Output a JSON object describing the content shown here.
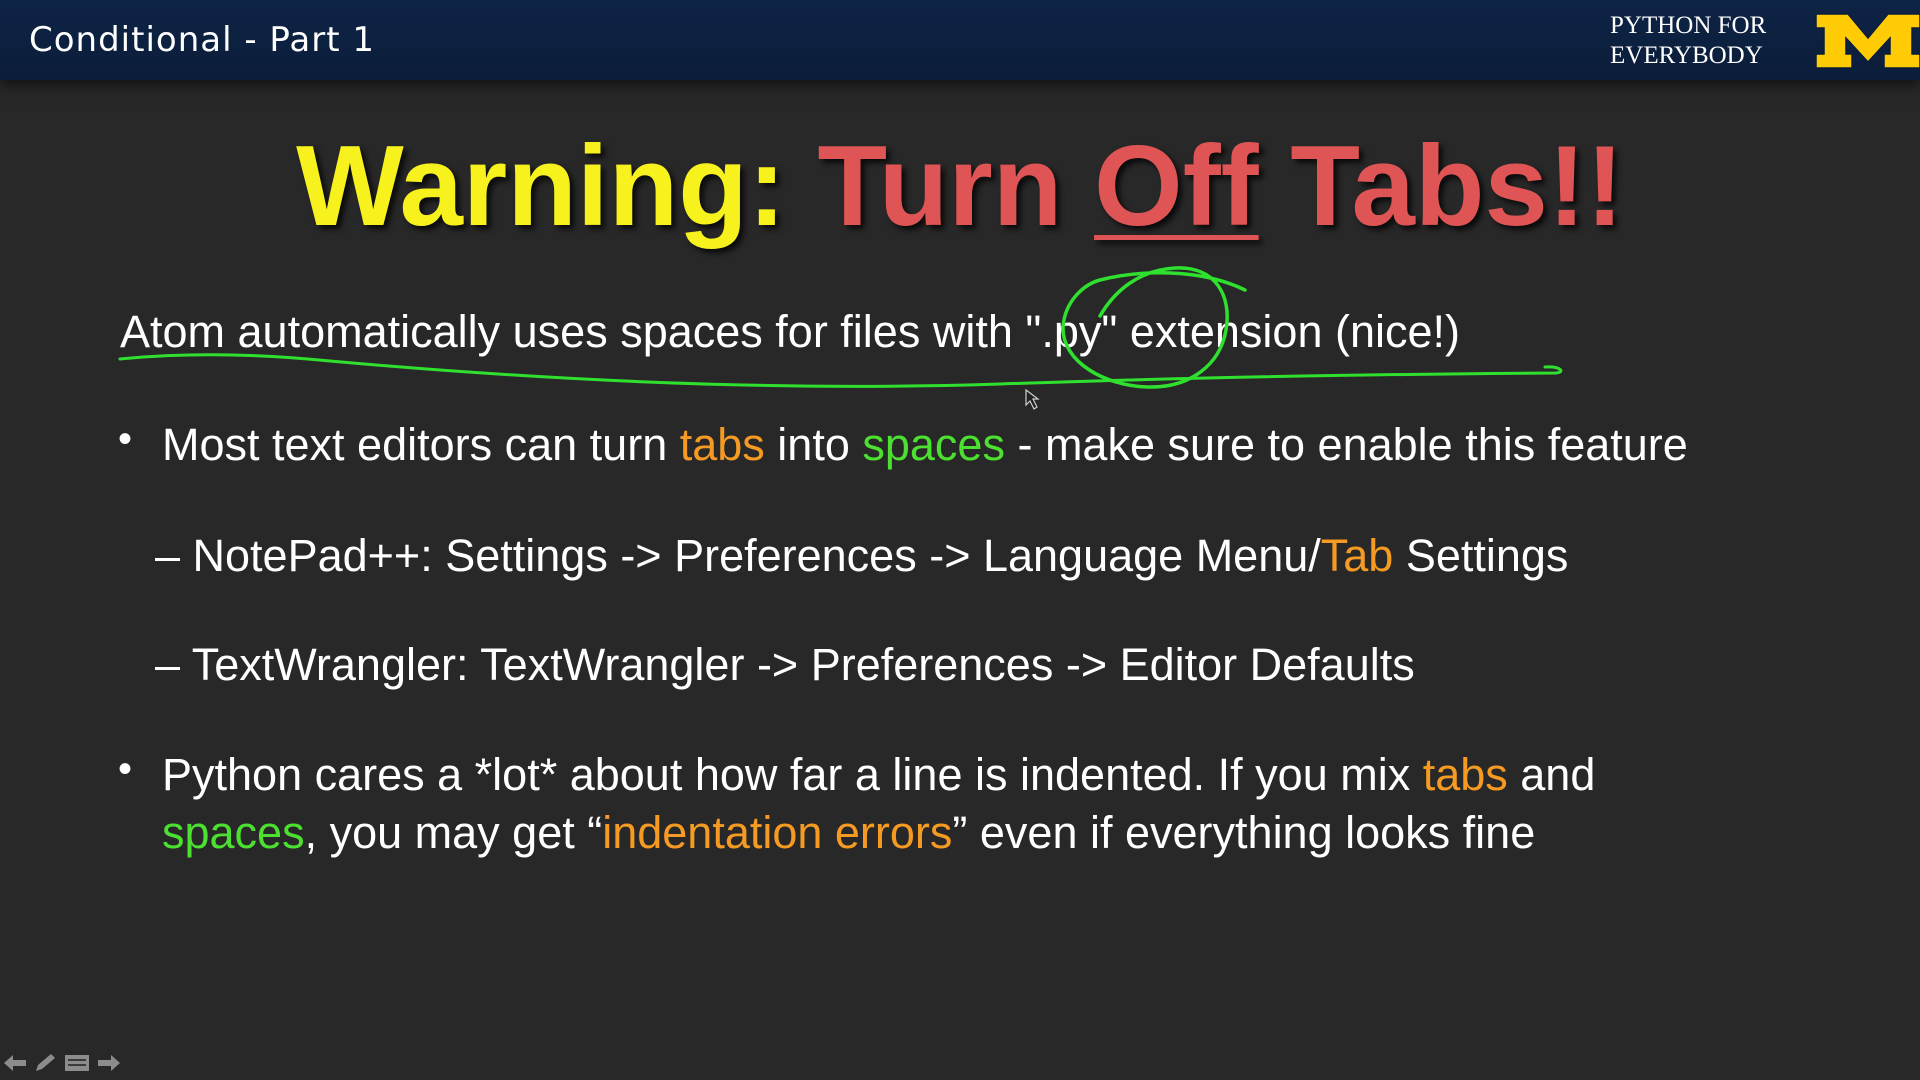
{
  "header": {
    "title": "Conditional - Part 1",
    "brand_line1": "PYTHON FOR",
    "brand_line2": "EVERYBODY",
    "logo_icon": "michigan-block-m-logo",
    "logo_color": "#ffcb05"
  },
  "slide": {
    "title": {
      "warning": "Warning:",
      "turn": "Turn",
      "off": "Off",
      "tabs": "Tabs!!"
    },
    "atom_line": "Atom automatically uses spaces for files with \".py\" extension (nice!)",
    "bullet1": {
      "p1": "Most text editors can turn ",
      "tabs": "tabs",
      "p2": " into ",
      "spaces": "spaces",
      "p3": " - make sure to enable this feature"
    },
    "sub1": {
      "p1": "– NotePad++:  Settings -> Preferences -> Language Menu/",
      "tab": "Tab",
      "p2": " Settings"
    },
    "sub2": "– TextWrangler:  TextWrangler -> Preferences -> Editor Defaults",
    "bullet2": {
      "l1a": "Python cares a *lot* about how far a line is indented.  If you mix ",
      "tabs": "tabs",
      "l1b": " and",
      "spaces": "spaces",
      "l2a": ", you may get “",
      "errors": "indentation errors",
      "l2b": "” even if everything looks fine"
    }
  },
  "colors": {
    "background": "#282828",
    "header": "#0e2446",
    "title_yellow": "#f7f21e",
    "title_red": "#df5454",
    "highlight_orange": "#f59a22",
    "highlight_green": "#4ce030",
    "annotation_green": "#2fe02f"
  },
  "nav_controls": [
    "previous-slide-icon",
    "pen-icon",
    "menu-icon",
    "next-slide-icon"
  ]
}
